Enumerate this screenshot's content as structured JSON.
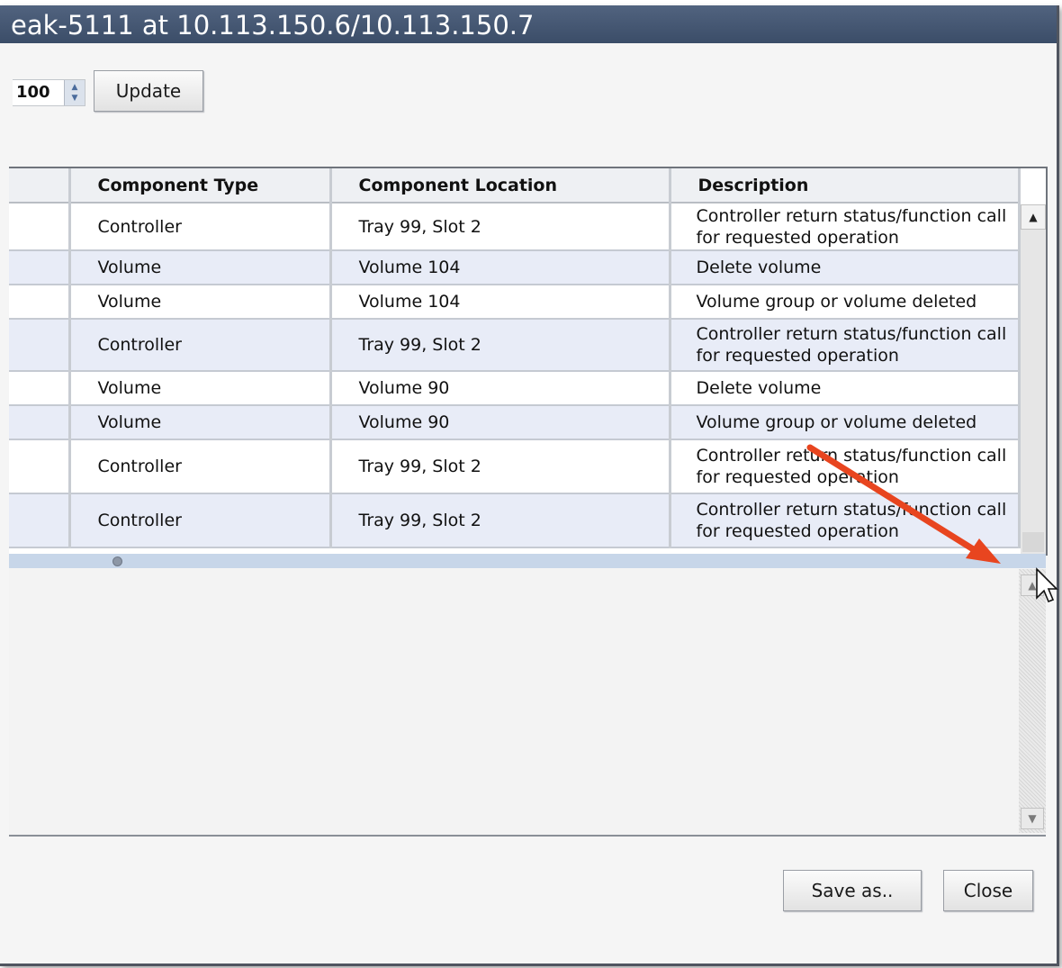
{
  "window": {
    "title": "eak-5111 at 10.113.150.6/10.113.150.7"
  },
  "toolbar": {
    "count_value": "100",
    "update_label": "Update"
  },
  "table": {
    "headers": [
      "",
      "Component Type",
      "Component Location",
      "Description"
    ],
    "rows": [
      {
        "type": "Controller",
        "location": "Tray 99, Slot 2",
        "desc_line1": "Controller return status/function call",
        "desc_line2": "for requested operation"
      },
      {
        "type": "Volume",
        "location": "Volume 104",
        "desc_line1": "Delete volume",
        "desc_line2": ""
      },
      {
        "type": "Volume",
        "location": "Volume 104",
        "desc_line1": "Volume group or volume deleted",
        "desc_line2": ""
      },
      {
        "type": "Controller",
        "location": "Tray 99, Slot 2",
        "desc_line1": "Controller return status/function call",
        "desc_line2": "for requested operation"
      },
      {
        "type": "Volume",
        "location": "Volume 90",
        "desc_line1": "Delete volume",
        "desc_line2": ""
      },
      {
        "type": "Volume",
        "location": "Volume 90",
        "desc_line1": "Volume group or volume deleted",
        "desc_line2": ""
      },
      {
        "type": "Controller",
        "location": "Tray 99, Slot 2",
        "desc_line1": "Controller return status/function call",
        "desc_line2": "for requested operation"
      },
      {
        "type": "Controller",
        "location": "Tray 99, Slot 2",
        "desc_line1": "Controller return status/function call",
        "desc_line2": "for requested operation"
      }
    ]
  },
  "buttons": {
    "save_label": "Save as..",
    "close_label": "Close"
  },
  "icons": {
    "spinner": "spinner-arrows-icon",
    "scroll_up": "scroll-up-arrow-icon",
    "scroll_down": "scroll-down-arrow-icon",
    "annotation": "red-arrow-annotation-icon",
    "cursor": "resize-cursor-icon"
  },
  "colors": {
    "titlebar": "#44556f",
    "row_alt": "#e8ecf7",
    "annotation_arrow": "#e8451f"
  }
}
